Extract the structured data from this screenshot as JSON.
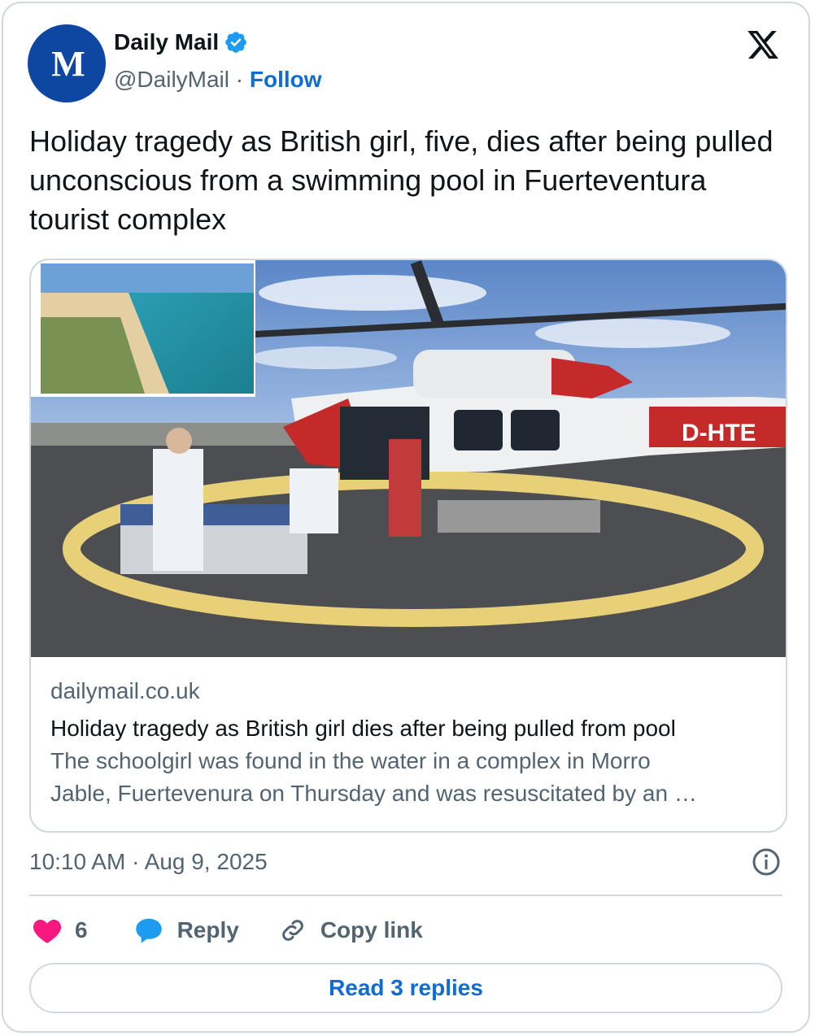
{
  "account": {
    "name": "Daily Mail",
    "handle": "@DailyMail",
    "separator": " · ",
    "follow_label": "Follow",
    "avatar_monogram": "M"
  },
  "tweet": {
    "text": "Holiday tragedy as British girl, five, dies after being pulled unconscious from a swimming pool in Fuerteventura tourist complex"
  },
  "link_card": {
    "domain": "dailymail.co.uk",
    "title": "Holiday tragedy as British girl dies after being pulled from pool",
    "description_line1": "The schoolgirl was found in the water in a complex in Morro",
    "description_line2": "Jable, Fuertevenura on Thursday and was resuscitated by an …",
    "helicopter_registration": "D-HTE"
  },
  "meta": {
    "timestamp": "10:10 AM · Aug 9, 2025"
  },
  "actions": {
    "like_count": "6",
    "reply_label": "Reply",
    "copy_link_label": "Copy link"
  },
  "read_replies_label": "Read 3 replies",
  "icons": [
    "verified-badge-icon",
    "x-logo-icon",
    "info-icon",
    "heart-icon",
    "reply-bubble-icon",
    "link-icon"
  ],
  "colors": {
    "accent": "#0f6bd6",
    "heart": "#f91880",
    "border": "#cfd9de",
    "muted": "#536471"
  }
}
